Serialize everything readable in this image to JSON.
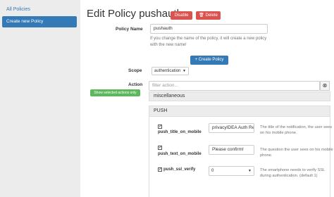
{
  "sidebar": {
    "all_policies": "All Policies",
    "create_new": "Create new Policy"
  },
  "header": {
    "title": "Edit Policy pushauth",
    "disable_label": "Disable",
    "delete_label": "Delete"
  },
  "form": {
    "policy_name_label": "Policy Name",
    "policy_name_value": "pushauth",
    "policy_name_help": "If you change the name of the policy, it will create a new policy with the new name!",
    "create_button": "Create Policy",
    "scope_label": "Scope",
    "scope_value": "authentication",
    "action_label": "Action",
    "filter_placeholder": "filter action...",
    "show_selected": "Show selected actions only",
    "clear_icon": "times-circle-icon"
  },
  "groups": {
    "misc": "miscellaneous",
    "push": "PUSH"
  },
  "actions": [
    {
      "name": "push_title_on_mobile",
      "value": "privacyIDEA Auth Re",
      "help": "The title of the notification, the user sees on his mobile phone."
    },
    {
      "name": "push_text_on_mobile",
      "value": "Please confirm!",
      "help": "The question the user sees on his mobile phone."
    },
    {
      "name": "push_ssl_verify",
      "value": "0",
      "help": "The smartphone needs to verify SSL during authentication. (default 1)"
    }
  ],
  "icons": {
    "plus": "plus-icon",
    "trash": "trash-icon",
    "check": "checkmark-icon"
  },
  "colors": {
    "primary": "#337ab7",
    "danger": "#d9534f",
    "success": "#5cb85c"
  }
}
